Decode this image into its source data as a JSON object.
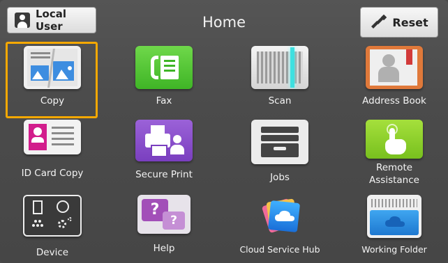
{
  "header": {
    "user_label": "Local User",
    "title": "Home",
    "reset_label": "Reset"
  },
  "apps": [
    {
      "label": "Copy",
      "icon": "copy-icon",
      "selected": true
    },
    {
      "label": "Fax",
      "icon": "fax-icon"
    },
    {
      "label": "Scan",
      "icon": "scan-icon"
    },
    {
      "label": "Address Book",
      "icon": "address-book-icon"
    },
    {
      "label": "ID Card Copy",
      "icon": "id-card-icon"
    },
    {
      "label": "Secure Print",
      "icon": "secure-print-icon"
    },
    {
      "label": "Jobs",
      "icon": "jobs-icon"
    },
    {
      "label": "Remote Assistance",
      "label_line1": "Remote",
      "label_line2": "Assistance",
      "icon": "remote-assistance-icon"
    },
    {
      "label": "Device",
      "icon": "device-icon"
    },
    {
      "label": "Help",
      "icon": "help-icon"
    },
    {
      "label": "Cloud Service Hub",
      "icon": "cloud-service-hub-icon"
    },
    {
      "label": "Working Folder",
      "icon": "working-folder-icon"
    }
  ],
  "colors": {
    "selection_outline": "#f5a800",
    "fax_green": "#5cc93a",
    "secure_print_purple": "#8a4fc8",
    "remote_green": "#8ccc2a"
  }
}
